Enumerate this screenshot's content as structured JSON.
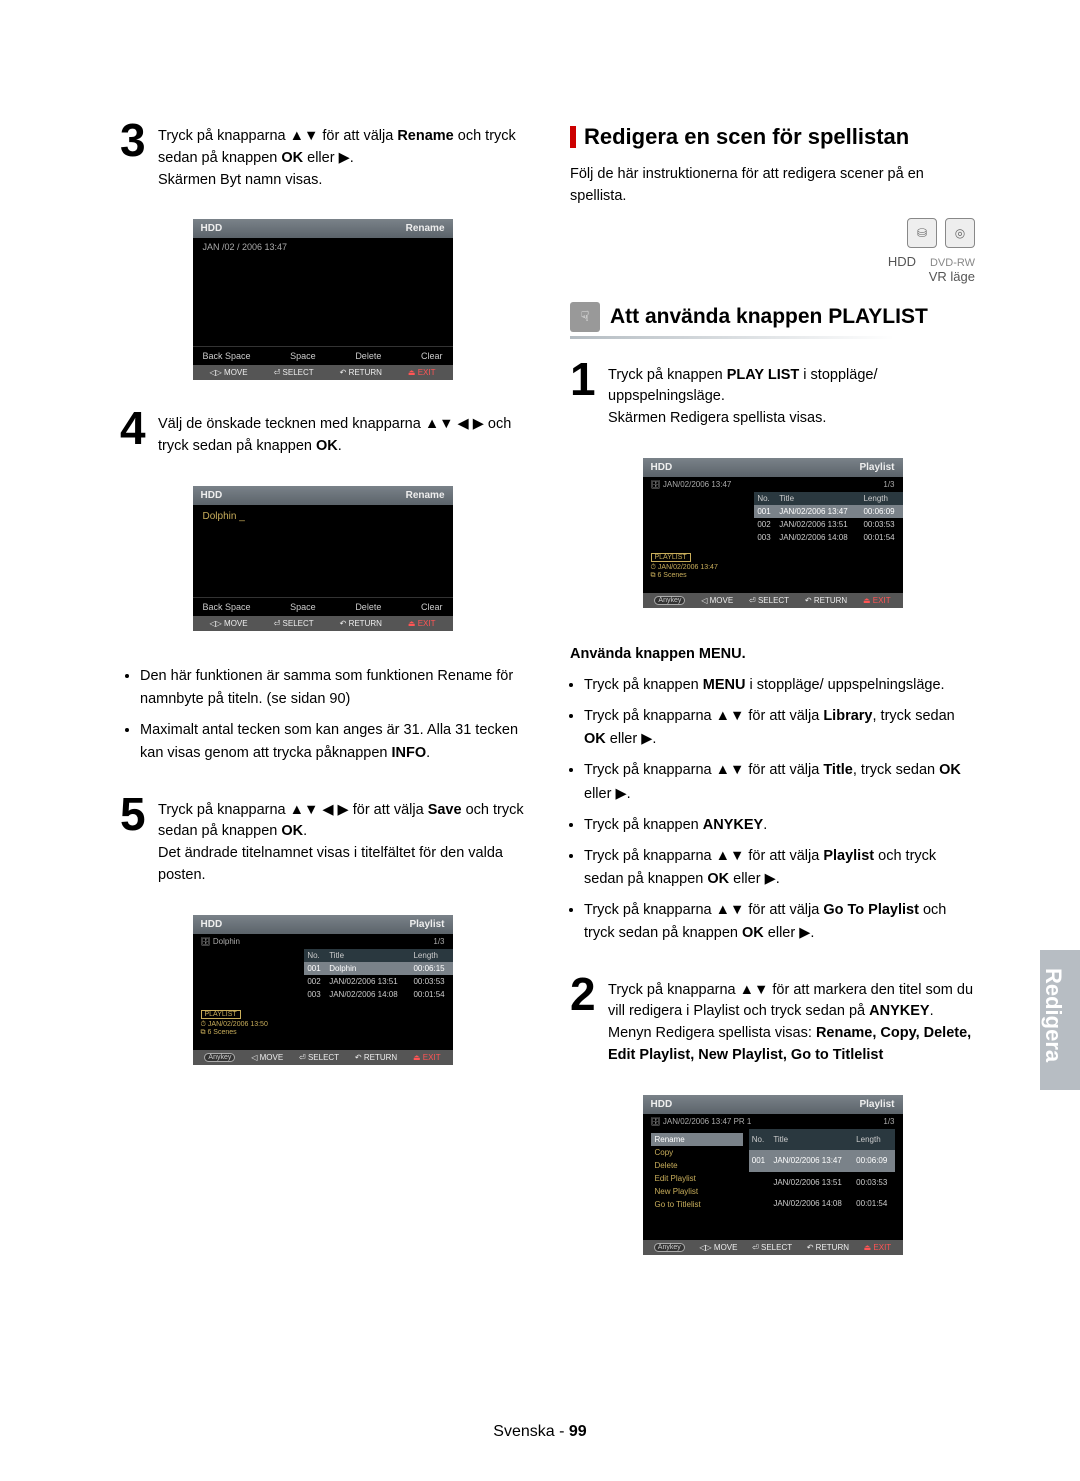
{
  "symbols": {
    "ud": "▲▼",
    "udlr": "▲▼ ◀ ▶",
    "right": "▶"
  },
  "left": {
    "step3": {
      "num": "3",
      "text_a": "Tryck på knapparna ",
      "text_b": " för att välja ",
      "bold1": "Rename",
      "text_c": " och tryck sedan på knappen ",
      "bold2": "OK",
      "text_d": " eller ",
      "text_e": ".",
      "line2": "Skärmen Byt namn visas."
    },
    "osd_a": {
      "hl": "HDD",
      "hr": "Rename",
      "sub": "JAN /02 / 2006  13:47",
      "keys": [
        "Back Space",
        "Space",
        "Delete",
        "Clear"
      ],
      "footer": [
        "◁▷ MOVE",
        "⏎ SELECT",
        "↶ RETURN",
        "⏏ EXIT"
      ]
    },
    "step4": {
      "num": "4",
      "text_a": "Välj de önskade tecknen med knapparna ",
      "text_b": " och tryck sedan på knappen ",
      "bold1": "OK",
      "end": "."
    },
    "osd_b": {
      "hl": "HDD",
      "hr": "Rename",
      "body": "Dolphin _",
      "keys": [
        "Back Space",
        "Space",
        "Delete",
        "Clear"
      ],
      "footer": [
        "◁▷ MOVE",
        "⏎ SELECT",
        "↶ RETURN",
        "⏏ EXIT"
      ]
    },
    "bullets": [
      {
        "a": "Den här funktionen är samma som funktionen Rename för namnbyte på titeln. (se sidan 90)"
      },
      {
        "a": "Maximalt antal tecken som kan anges är 31. Alla 31 tecken kan visas genom att trycka påknappen ",
        "b": "INFO",
        "c": "."
      }
    ],
    "step5": {
      "num": "5",
      "text_a": "Tryck på knapparna ",
      "text_b": "  för att välja ",
      "bold1": "Save",
      "text_c": " och tryck sedan på knappen ",
      "bold2": "OK",
      "end": ".",
      "line2": "Det ändrade titelnamnet visas i titelfältet för den valda posten."
    },
    "osd_c": {
      "hl": "HDD",
      "hr": "Playlist",
      "sub": "🗄 Dolphin",
      "count": "1/3",
      "cols": [
        "No.",
        "Title",
        "Length"
      ],
      "rows": [
        {
          "no": "001",
          "title": "Dolphin",
          "len": "00:06:15",
          "hl": true
        },
        {
          "no": "002",
          "title": "JAN/02/2006 13:51",
          "len": "00:03:53"
        },
        {
          "no": "003",
          "title": "JAN/02/2006 14:08",
          "len": "00:01:54"
        }
      ],
      "info": [
        "PLAYLIST",
        "⏱ JAN/02/2006 13:50",
        "⧉ 6 Scenes"
      ],
      "footer": [
        "Anykey",
        "◁ MOVE",
        "⏎ SELECT",
        "↶ RETURN",
        "⏏ EXIT"
      ]
    }
  },
  "right": {
    "title": "Redigera en scen för spellistan",
    "intro": "Följ de här instruktionerna för att redigera scener på en spellista.",
    "mode": {
      "hdd": "HDD",
      "dvdrw": "DVD-RW",
      "vr": "VR läge"
    },
    "sub_title": "Att använda knappen PLAYLIST",
    "step1": {
      "num": "1",
      "text_a": "Tryck på knappen ",
      "bold1": "PLAY LIST",
      "text_b": " i stoppläge/ uppspelningsläge.",
      "line2": "Skärmen Redigera spellista visas."
    },
    "osd_d": {
      "hl": "HDD",
      "hr": "Playlist",
      "sub": "🗄 JAN/02/2006 13:47",
      "count": "1/3",
      "cols": [
        "No.",
        "Title",
        "Length"
      ],
      "rows": [
        {
          "no": "001",
          "title": "JAN/02/2006 13:47",
          "len": "00:06:09",
          "hl": true
        },
        {
          "no": "002",
          "title": "JAN/02/2006 13:51",
          "len": "00:03:53"
        },
        {
          "no": "003",
          "title": "JAN/02/2006 14:08",
          "len": "00:01:54"
        }
      ],
      "info": [
        "PLAYLIST",
        "⏱ JAN/02/2006 13:47",
        "⧉ 6 Scenes"
      ],
      "footer": [
        "Anykey",
        "◁ MOVE",
        "⏎ SELECT",
        "↶ RETURN",
        "⏏ EXIT"
      ]
    },
    "menu_heading": "Använda knappen MENU.",
    "menu_bullets": [
      {
        "a": "Tryck på knappen ",
        "b": "MENU",
        "c": " i stoppläge/ uppspelningsläge."
      },
      {
        "a": "Tryck på knapparna ",
        "s": "ud",
        "c": " för att välja ",
        "b": "Library",
        "d": ", tryck sedan ",
        "b2": "OK",
        "e": " eller ",
        "f": "."
      },
      {
        "a": "Tryck på knapparna ",
        "s": "ud",
        "c": " för att välja ",
        "b": "Title",
        "d": ", tryck sedan ",
        "b2": "OK",
        "e": " eller ",
        "f": "."
      },
      {
        "a": "Tryck på knappen ",
        "b": "ANYKEY",
        "c": "."
      },
      {
        "a": "Tryck på knapparna ",
        "s": "ud",
        "c": " för att välja ",
        "b": "Playlist",
        "d": " och tryck sedan på knappen ",
        "b2": "OK",
        "e": " eller ",
        "f": "."
      },
      {
        "a": "Tryck på knapparna ",
        "s": "ud",
        "c": " för att välja ",
        "b": "Go To Playlist",
        "d": " och tryck sedan på knappen ",
        "b2": "OK",
        "e": " eller ",
        "f": "."
      }
    ],
    "step2": {
      "num": "2",
      "text_a": "Tryck på knapparna ",
      "text_b": " för att markera den titel som du vill redigera i Playlist och tryck sedan på ",
      "bold1": "ANYKEY",
      "end": ".",
      "line2a": "Menyn Redigera spellista visas: ",
      "line2b": "Rename, Copy, Delete, Edit Playlist, New Playlist, Go to Titlelist"
    },
    "osd_e": {
      "hl": "HDD",
      "hr": "Playlist",
      "sub": "🗄 JAN/02/2006 13:47 PR 1",
      "count": "1/3",
      "cols": [
        "No.",
        "Title",
        "Length"
      ],
      "rows": [
        {
          "no": "001",
          "title": "JAN/02/2006 13:47",
          "len": "00:06:09",
          "hl": true
        },
        {
          "no": "",
          "title": "JAN/02/2006 13:51",
          "len": "00:03:53"
        },
        {
          "no": "",
          "title": "JAN/02/2006 14:08",
          "len": "00:01:54"
        }
      ],
      "menu": [
        "Rename",
        "Copy",
        "Delete",
        "Edit Playlist",
        "New Playlist",
        "Go to Titlelist"
      ],
      "footer": [
        "Anykey",
        "◁▷ MOVE",
        "⏎ SELECT",
        "↶ RETURN",
        "⏏ EXIT"
      ]
    }
  },
  "side_tab": "Redigera",
  "footer": {
    "a": "Svenska - ",
    "b": "99"
  }
}
